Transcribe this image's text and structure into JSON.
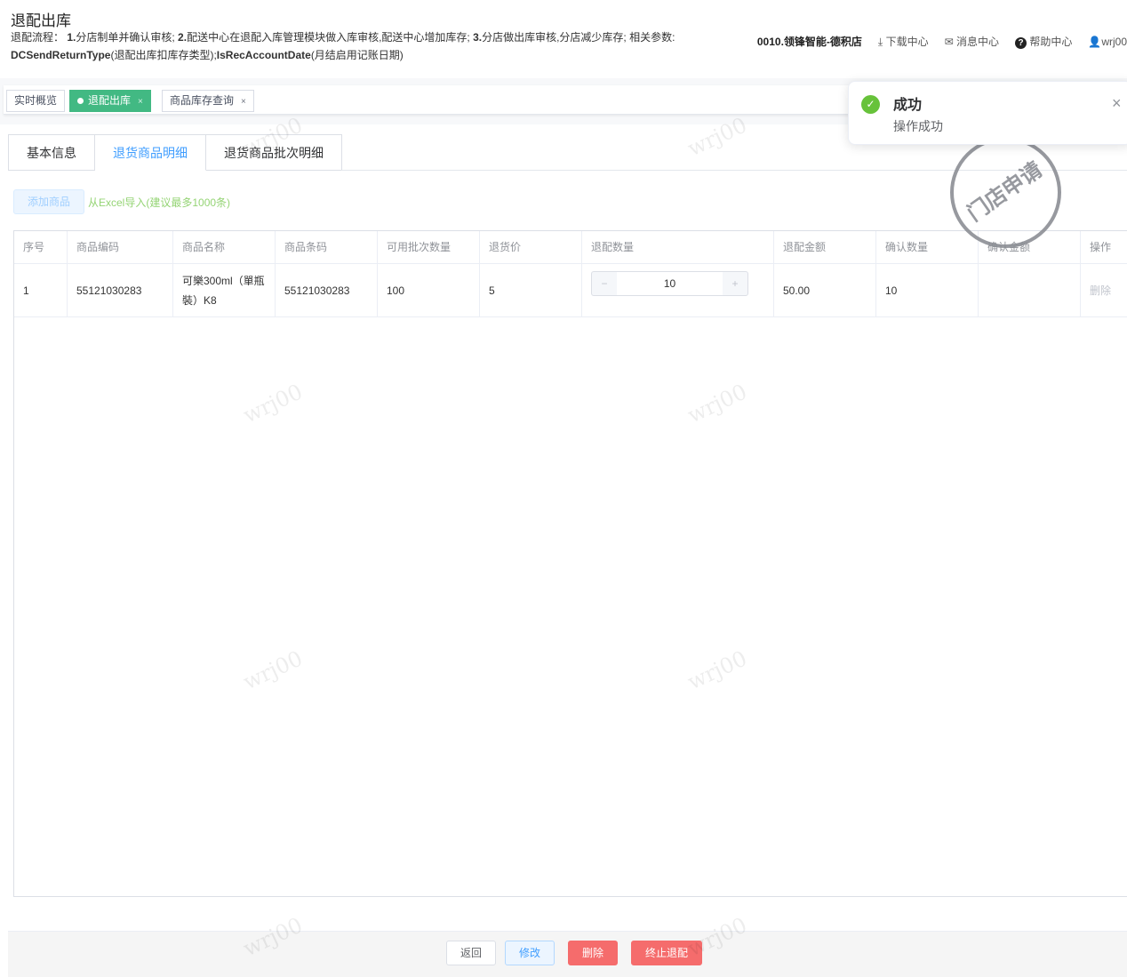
{
  "page": {
    "title": "退配出库",
    "desc_prefix": "退配流程：",
    "desc_s1": "1.",
    "desc_t1": "分店制单并确认审核; ",
    "desc_s2": "2.",
    "desc_t2": "配送中心在退配入库管理模块做入库审核,配送中心增加库存; ",
    "desc_s3": "3.",
    "desc_t3": "分店做出库审核,分店减少库存; 相关参数: ",
    "desc_p1": "DCSendReturnType",
    "desc_p1t": "(退配出库扣库存类型);",
    "desc_p2": "IsRecAccountDate",
    "desc_p2t": "(月结启用记账日期)"
  },
  "topnav": {
    "store": "0010.领锋智能-德积店",
    "download": "下载中心",
    "messages": "消息中心",
    "help": "帮助中心",
    "user": "wrj00"
  },
  "tags": [
    {
      "label": "实时概览"
    },
    {
      "label": "退配出库"
    },
    {
      "label": "商品库存查询"
    }
  ],
  "tabs": [
    "基本信息",
    "退货商品明细",
    "退货商品批次明细"
  ],
  "toolbar": {
    "add": "添加商品",
    "excel": "从Excel导入(建议最多1000条)"
  },
  "table": {
    "headers": [
      "序号",
      "商品编码",
      "商品名称",
      "商品条码",
      "可用批次数量",
      "退货价",
      "退配数量",
      "退配金额",
      "确认数量",
      "确认金额",
      "操作"
    ],
    "rows": [
      {
        "no": "1",
        "code": "55121030283",
        "name": "可樂300ml（單瓶裝）K8",
        "barcode": "55121030283",
        "batch_qty": "100",
        "price": "5",
        "qty": "10",
        "amount": "50.00",
        "confirm_qty": "10",
        "confirm_amount": "",
        "action": "删除"
      }
    ]
  },
  "footer": {
    "back": "返回",
    "edit": "修改",
    "delete": "删除",
    "stop": "终止退配"
  },
  "notification": {
    "title": "成功",
    "message": "操作成功"
  },
  "stamp": "门店申请",
  "watermark": "wrj00",
  "colors": {
    "accent": "#409eff",
    "tag_active": "#42b983",
    "danger": "#f56c6c",
    "success": "#67c23a"
  }
}
